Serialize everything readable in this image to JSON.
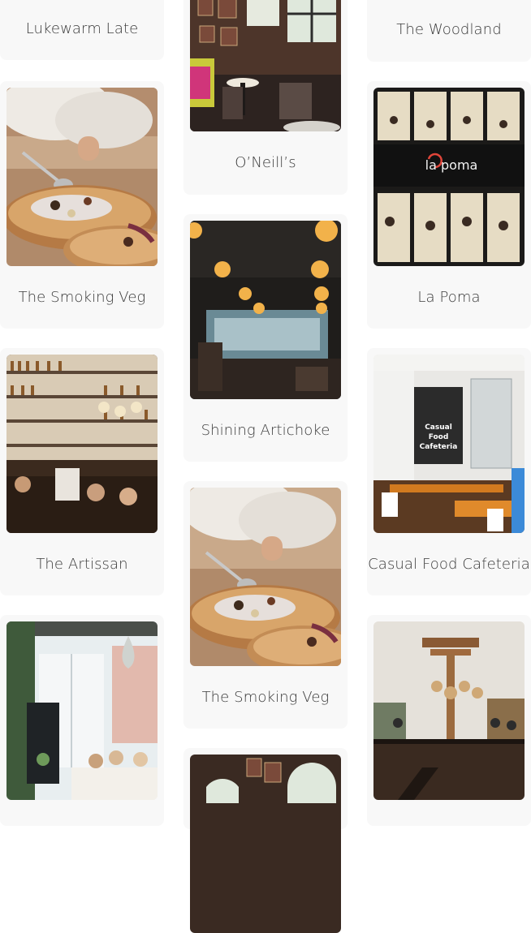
{
  "columns": {
    "left": [
      {
        "name": "Lukewarm Late",
        "photo": "none"
      },
      {
        "name": "The Smoking Veg",
        "photo": "smoking-veg"
      },
      {
        "name": "The Artissan",
        "photo": "bar"
      },
      {
        "name": "",
        "photo": "bright-dining"
      }
    ],
    "middle": [
      {
        "name": "O’Neill’s",
        "photo": "pub-interior"
      },
      {
        "name": "Shining Artichoke",
        "photo": "lamps-dark"
      },
      {
        "name": "The Smoking Veg",
        "photo": "smoking-veg"
      },
      {
        "name": "",
        "photo": "pub-interior"
      }
    ],
    "right": [
      {
        "name": "The Woodland",
        "photo": "none"
      },
      {
        "name": "La Poma",
        "photo": "storefront",
        "sign": "la poma"
      },
      {
        "name": "Casual Food Cafeteria",
        "photo": "cafeteria",
        "sign": [
          "Casual",
          "Food",
          "Cafeteria"
        ]
      },
      {
        "name": "",
        "photo": "wood-cafe"
      }
    ]
  },
  "colors": {
    "card_bg": "#f8f8f8",
    "label_text": "#3a3a3a"
  }
}
